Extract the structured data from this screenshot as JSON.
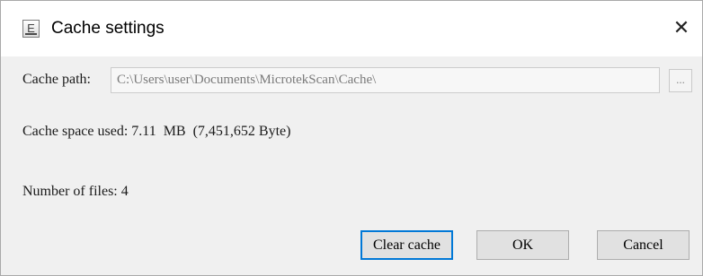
{
  "window": {
    "title": "Cache settings",
    "icon_letter": "E",
    "close_glyph": "✕"
  },
  "cache_path": {
    "label": "Cache path:",
    "value": "C:\\Users\\user\\Documents\\MicrotekScan\\Cache\\",
    "browse_label": "..."
  },
  "space_used": {
    "label": "Cache space used:",
    "value": "7.11  MB  (7,451,652 Byte)"
  },
  "files": {
    "label": "Number of files:",
    "value": "4"
  },
  "buttons": {
    "clear_cache": "Clear cache",
    "ok": "OK",
    "cancel": "Cancel"
  },
  "colors": {
    "accent": "#0078d7",
    "dialog_background": "#f0f0f0",
    "button_face": "#e1e1e1"
  }
}
